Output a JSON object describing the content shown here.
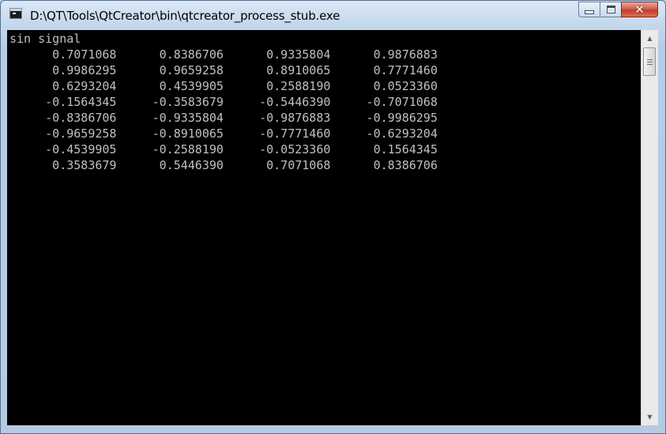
{
  "window": {
    "title": "D:\\QT\\Tools\\QtCreator\\bin\\qtcreator_process_stub.exe",
    "icon": "console-app-icon",
    "buttons": {
      "minimize": "minimize-icon",
      "maximize": "maximize-icon",
      "close": "✕"
    }
  },
  "console": {
    "background": "#000000",
    "text_color": "#c0c0c0",
    "lines": [
      "sin signal",
      "      0.7071068      0.8386706      0.9335804      0.9876883",
      "      0.9986295      0.9659258      0.8910065      0.7771460",
      "      0.6293204      0.4539905      0.2588190      0.0523360",
      "     -0.1564345     -0.3583679     -0.5446390     -0.7071068",
      "     -0.8386706     -0.9335804     -0.9876883     -0.9986295",
      "     -0.9659258     -0.8910065     -0.7771460     -0.6293204",
      "     -0.4539905     -0.2588190     -0.0523360      0.1564345",
      "      0.3583679      0.5446390      0.7071068      0.8386706"
    ]
  },
  "scrollbar": {
    "up_arrow": "▲",
    "down_arrow": "▼"
  }
}
